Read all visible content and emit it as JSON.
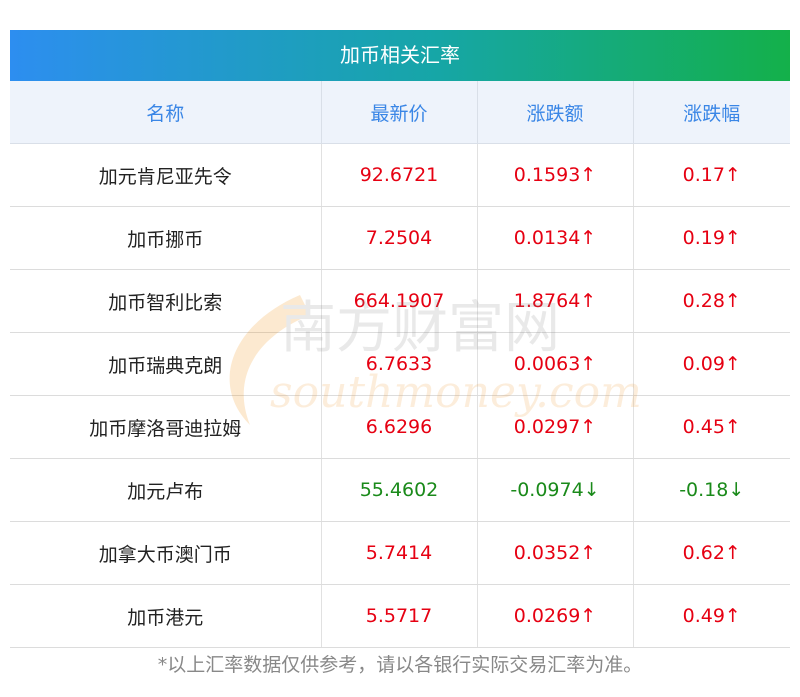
{
  "header": {
    "title": "加币相关汇率"
  },
  "columns": [
    "名称",
    "最新价",
    "涨跌额",
    "涨跌幅"
  ],
  "rows": [
    {
      "name": "加元肯尼亚先令",
      "price": "92.6721",
      "change": "0.1593↑",
      "pct": "0.17↑",
      "dir": "up"
    },
    {
      "name": "加币挪币",
      "price": "7.2504",
      "change": "0.0134↑",
      "pct": "0.19↑",
      "dir": "up"
    },
    {
      "name": "加币智利比索",
      "price": "664.1907",
      "change": "1.8764↑",
      "pct": "0.28↑",
      "dir": "up"
    },
    {
      "name": "加币瑞典克朗",
      "price": "6.7633",
      "change": "0.0063↑",
      "pct": "0.09↑",
      "dir": "up"
    },
    {
      "name": "加币摩洛哥迪拉姆",
      "price": "6.6296",
      "change": "0.0297↑",
      "pct": "0.45↑",
      "dir": "up"
    },
    {
      "name": "加元卢布",
      "price": "55.4602",
      "change": "-0.0974↓",
      "pct": "-0.18↓",
      "dir": "down"
    },
    {
      "name": "加拿大币澳门币",
      "price": "5.7414",
      "change": "0.0352↑",
      "pct": "0.62↑",
      "dir": "up"
    },
    {
      "name": "加币港元",
      "price": "5.5717",
      "change": "0.0269↑",
      "pct": "0.49↑",
      "dir": "up"
    }
  ],
  "watermark": {
    "cn": "南方财富网",
    "en": "southmoney.com"
  },
  "footer": {
    "note": "*以上汇率数据仅供参考，请以各银行实际交易汇率为准。"
  },
  "colors": {
    "up": "#e60012",
    "down": "#1a8a1a",
    "header_text": "#3a86e6"
  }
}
